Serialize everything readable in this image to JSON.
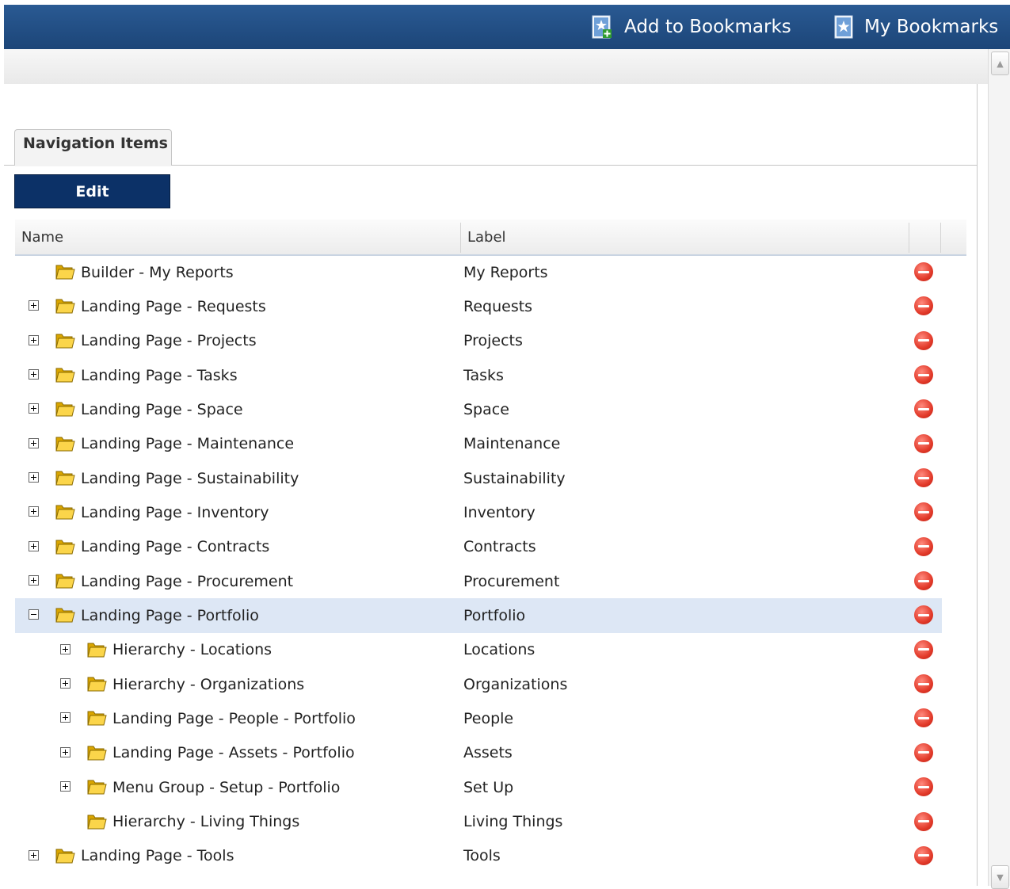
{
  "header": {
    "add_bookmarks_label": "Add to Bookmarks",
    "my_bookmarks_label": "My Bookmarks"
  },
  "tab": {
    "label": "Navigation Items"
  },
  "toolbar": {
    "edit_label": "Edit"
  },
  "grid": {
    "columns": [
      "Name",
      "Label"
    ],
    "rows": [
      {
        "name": "Builder - My Reports",
        "label": "My Reports",
        "level": 0,
        "expander": "none",
        "selected": false
      },
      {
        "name": "Landing Page - Requests",
        "label": "Requests",
        "level": 0,
        "expander": "plus",
        "selected": false
      },
      {
        "name": "Landing Page - Projects",
        "label": "Projects",
        "level": 0,
        "expander": "plus",
        "selected": false
      },
      {
        "name": "Landing Page - Tasks",
        "label": "Tasks",
        "level": 0,
        "expander": "plus",
        "selected": false
      },
      {
        "name": "Landing Page - Space",
        "label": "Space",
        "level": 0,
        "expander": "plus",
        "selected": false
      },
      {
        "name": "Landing Page - Maintenance",
        "label": "Maintenance",
        "level": 0,
        "expander": "plus",
        "selected": false
      },
      {
        "name": "Landing Page - Sustainability",
        "label": "Sustainability",
        "level": 0,
        "expander": "plus",
        "selected": false
      },
      {
        "name": "Landing Page - Inventory",
        "label": "Inventory",
        "level": 0,
        "expander": "plus",
        "selected": false
      },
      {
        "name": "Landing Page - Contracts",
        "label": "Contracts",
        "level": 0,
        "expander": "plus",
        "selected": false
      },
      {
        "name": "Landing Page - Procurement",
        "label": "Procurement",
        "level": 0,
        "expander": "plus",
        "selected": false
      },
      {
        "name": "Landing Page - Portfolio",
        "label": "Portfolio",
        "level": 0,
        "expander": "minus",
        "selected": true
      },
      {
        "name": "Hierarchy - Locations",
        "label": "Locations",
        "level": 1,
        "expander": "plus",
        "selected": false
      },
      {
        "name": "Hierarchy - Organizations",
        "label": "Organizations",
        "level": 1,
        "expander": "plus",
        "selected": false
      },
      {
        "name": "Landing Page - People - Portfolio",
        "label": "People",
        "level": 1,
        "expander": "plus",
        "selected": false
      },
      {
        "name": "Landing Page - Assets - Portfolio",
        "label": "Assets",
        "level": 1,
        "expander": "plus",
        "selected": false
      },
      {
        "name": "Menu Group - Setup - Portfolio",
        "label": "Set Up",
        "level": 1,
        "expander": "plus",
        "selected": false
      },
      {
        "name": "Hierarchy - Living Things",
        "label": "Living Things",
        "level": 1,
        "expander": "none",
        "selected": false
      },
      {
        "name": "Landing Page - Tools",
        "label": "Tools",
        "level": 0,
        "expander": "plus",
        "selected": false
      }
    ]
  },
  "icons": {
    "folder": "folder-icon",
    "remove": "remove-icon",
    "bookmark_add": "bookmark-add-icon",
    "bookmark": "bookmark-icon"
  },
  "colors": {
    "header_bar": "#1c4578",
    "edit_button": "#0c3167",
    "selected_row": "#dde7f5",
    "remove_icon": "#e23a2a",
    "folder": "#f5c518"
  }
}
